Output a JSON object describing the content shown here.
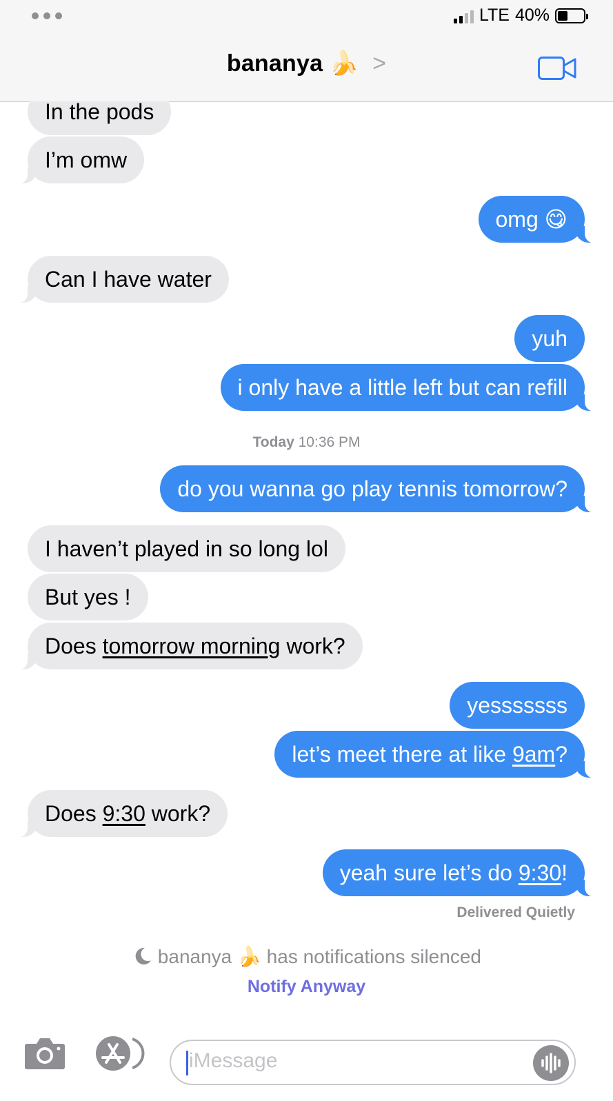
{
  "status_bar": {
    "network": "LTE",
    "battery": "40%",
    "battery_level": 0.4
  },
  "header": {
    "contact_name": "bananya",
    "contact_emoji": "🍌",
    "chevron": ">"
  },
  "messages": [
    {
      "dir": "in",
      "text": "In the pods"
    },
    {
      "dir": "in",
      "text": "I’m omw"
    },
    {
      "dir": "out",
      "text": "omg",
      "emoji": "😋"
    },
    {
      "dir": "in",
      "text": "Can I have water"
    },
    {
      "dir": "out",
      "text": "yuh"
    },
    {
      "dir": "out",
      "text": "i only have a little left but can refill"
    },
    {
      "dir": "out",
      "text": "do you wanna go play tennis tomorrow?"
    },
    {
      "dir": "in",
      "text": "I haven’t played in so long lol"
    },
    {
      "dir": "in",
      "text": "But yes !"
    },
    {
      "dir": "in",
      "parts": [
        "Does ",
        "tomorrow morning",
        " work?"
      ]
    },
    {
      "dir": "out",
      "text": "yesssssss"
    },
    {
      "dir": "out",
      "parts": [
        "let’s meet there at like ",
        "9am",
        "?"
      ]
    },
    {
      "dir": "in",
      "parts": [
        "Does ",
        "9:30",
        " work?"
      ]
    },
    {
      "dir": "out",
      "parts": [
        "yeah sure let’s do ",
        "9:30",
        "!"
      ]
    }
  ],
  "timestamp": {
    "day": "Today",
    "time": "10:36 PM"
  },
  "delivery_status": "Delivered Quietly",
  "silenced_notice": {
    "name": "bananya",
    "emoji": "🍌",
    "text": "has notifications silenced"
  },
  "notify_anyway": "Notify Anyway",
  "compose": {
    "placeholder": "iMessage"
  },
  "icons": [
    "more-dots-icon",
    "signal-icon",
    "battery-icon",
    "chevron-right-icon",
    "video-camera-icon",
    "moon-icon",
    "camera-icon",
    "app-store-icon",
    "audio-message-icon"
  ],
  "colors": {
    "outgoing_bubble": "#3a8cf2",
    "incoming_bubble": "#e9e9eb",
    "notify_link": "#6f6ee0"
  }
}
